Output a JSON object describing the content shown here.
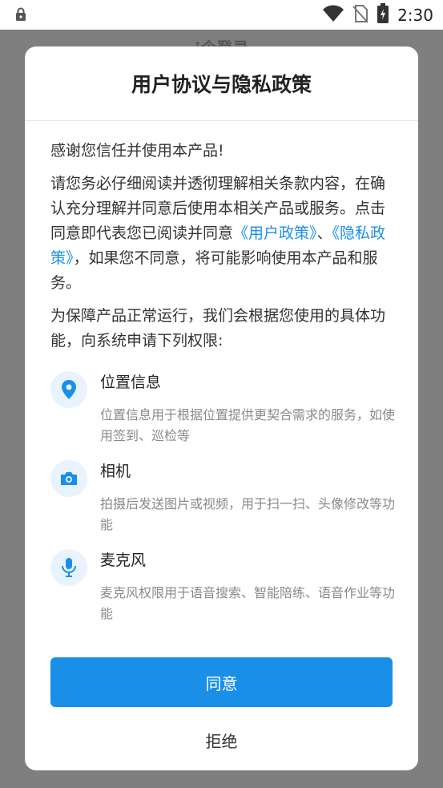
{
  "status_bar": {
    "time": "2:30",
    "icons": [
      "lock-icon",
      "wifi-icon",
      "no-sim-icon",
      "battery-charging-icon"
    ]
  },
  "background": {
    "title": "ꜛ企登录"
  },
  "dialog": {
    "title": "用户协议与隐私政策",
    "paragraphs": {
      "p1": "感谢您信任并使用本产品!",
      "p2_before": "请您务必仔细阅读并透彻理解相关条款内容，在确认充分理解并同意后使用本相关产品或服务。点击同意即代表您已阅读并同意",
      "link_user_policy": "《用户政策》",
      "separator": "、",
      "link_privacy_policy": "《隐私政策》",
      "p2_after": "，如果您不同意，将可能影响使用本产品和服务。",
      "p3": "为保障产品正常运行，我们会根据您使用的具体功能，向系统申请下列权限:"
    },
    "permissions": [
      {
        "icon": "location-pin-icon",
        "title": "位置信息",
        "desc": "位置信息用于根据位置提供更契合需求的服务，如使用签到、巡检等"
      },
      {
        "icon": "camera-icon",
        "title": "相机",
        "desc": "拍摄后发送图片或视频，用于扫一扫、头像修改等功能"
      },
      {
        "icon": "microphone-icon",
        "title": "麦克风",
        "desc": "麦克风权限用于语音搜索、智能陪练、语音作业等功能"
      }
    ],
    "agree_label": "同意",
    "reject_label": "拒绝"
  },
  "colors": {
    "accent": "#1a8fe8",
    "icon_bg": "#e8f3fd",
    "overlay": "#7f7f7f"
  }
}
